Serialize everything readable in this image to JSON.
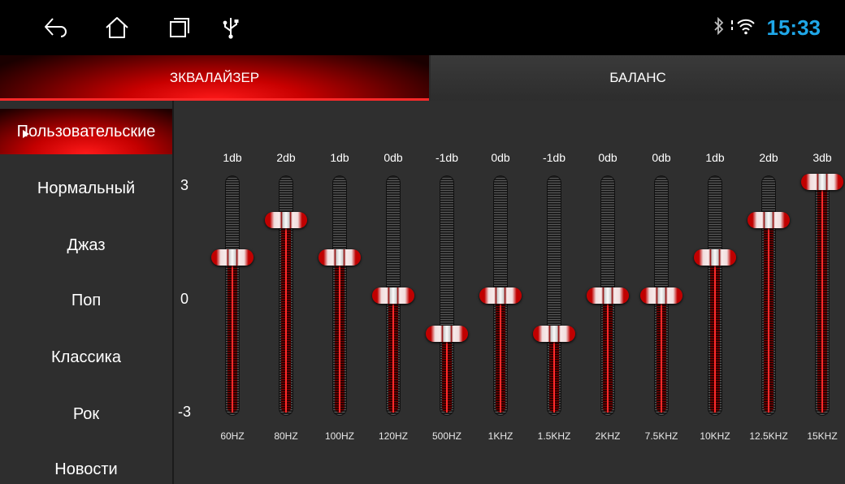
{
  "status": {
    "time": "15:33"
  },
  "tabs": [
    {
      "label": "ЗКВАЛАЙЗЕР",
      "active": true
    },
    {
      "label": "БАЛАНС",
      "active": false
    }
  ],
  "presets": [
    {
      "label": "Пользовательские",
      "active": true
    },
    {
      "label": "Нормальный"
    },
    {
      "label": "Джаз"
    },
    {
      "label": "Поп"
    },
    {
      "label": "Классика"
    },
    {
      "label": "Рок"
    },
    {
      "label": "Новости"
    }
  ],
  "scale": {
    "max": "3",
    "mid": "0",
    "min": "-3"
  },
  "bands": [
    {
      "label": "60HZ",
      "value_text": "1db",
      "value": 1
    },
    {
      "label": "80HZ",
      "value_text": "2db",
      "value": 2
    },
    {
      "label": "100HZ",
      "value_text": "1db",
      "value": 1
    },
    {
      "label": "120HZ",
      "value_text": "0db",
      "value": 0
    },
    {
      "label": "500HZ",
      "value_text": "-1db",
      "value": -1
    },
    {
      "label": "1KHZ",
      "value_text": "0db",
      "value": 0
    },
    {
      "label": "1.5KHZ",
      "value_text": "-1db",
      "value": -1
    },
    {
      "label": "2KHZ",
      "value_text": "0db",
      "value": 0
    },
    {
      "label": "7.5KHZ",
      "value_text": "0db",
      "value": 0
    },
    {
      "label": "10KHZ",
      "value_text": "1db",
      "value": 1
    },
    {
      "label": "12.5KHZ",
      "value_text": "2db",
      "value": 2
    },
    {
      "label": "15KHZ",
      "value_text": "3db",
      "value": 3
    }
  ],
  "colors": {
    "accent": "#ff1a1a",
    "clock": "#1fa7e8",
    "panel": "#2f2f2f"
  },
  "icons": [
    "back-icon",
    "home-icon",
    "recent-apps-icon",
    "usb-icon",
    "bluetooth-icon",
    "wifi-icon"
  ]
}
